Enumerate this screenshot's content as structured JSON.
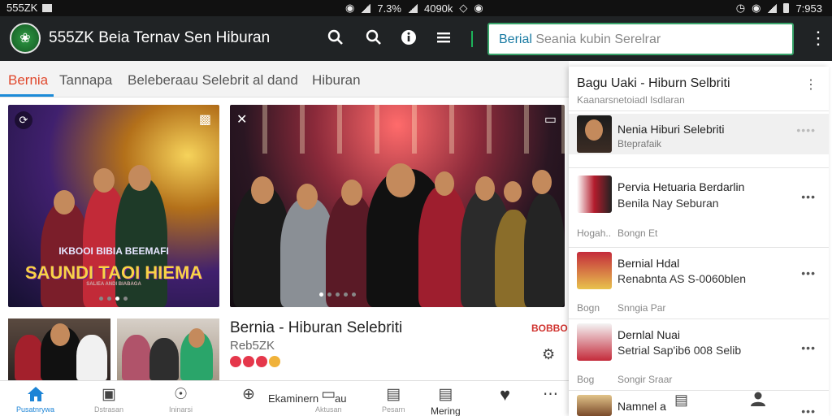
{
  "status_bar": {
    "carrier": "555ZK",
    "battery_percent": "7.3%",
    "speed": "4090k",
    "time": "7:953"
  },
  "app_bar": {
    "title": "555ZK Beia Ternav Sen Hiburan",
    "search": {
      "typed": "Berial",
      "placeholder": "Seania kubin Serelrar"
    },
    "icons": [
      "search-icon",
      "search-icon",
      "info-icon",
      "menu-icon",
      "more-vert-icon"
    ]
  },
  "tabs": [
    {
      "label": "Bernia",
      "active": true
    },
    {
      "label": "Tannapa",
      "active": false
    },
    {
      "label": "Beleberaau Selebrit al dand",
      "active": false
    },
    {
      "label": "Hiburan",
      "active": false
    }
  ],
  "hero": {
    "poster_title": "IKBOOI BIBIA BEEMAFI",
    "poster_headline": "SAUNDI TAOI HIEMA",
    "poster_credit": "SALIEA ANDI BIABAGA"
  },
  "feature": {
    "title": "Bernia - Hiburan Selebriti",
    "source": "Reb5ZK",
    "badge": "BOBBO"
  },
  "bottom_nav": [
    {
      "icon": "home-icon",
      "label": "Pusatnrywa",
      "active": true
    },
    {
      "icon": "image-icon",
      "label": "Dstrasan",
      "active": false
    },
    {
      "icon": "alert-circle-icon",
      "label": "Ininarsi",
      "active": false
    },
    {
      "icon": "plus-circle-icon",
      "label": "Ekaminern",
      "active": false
    },
    {
      "icon": "tv-icon",
      "label": "Au",
      "active": false
    },
    {
      "icon": "document-icon",
      "label": "Pesarn",
      "active": false
    },
    {
      "icon": "list-icon",
      "label": "Mering",
      "active": false
    },
    {
      "icon": "heart-icon",
      "label": "",
      "active": false
    },
    {
      "icon": "more-horiz-icon",
      "label": "",
      "active": false
    }
  ],
  "bottom_nav_texts": {
    "ekaminern": "Ekaminern",
    "au": "au",
    "mering": "Mering",
    "tv_sub": "Aktusan"
  },
  "panel": {
    "title": "Bagu Uaki - Hiburn Selbriti",
    "subtitle": "Kaanarsnetoiadl Isdlaran",
    "items": [
      {
        "line1": "Nenia Hiburi Selebriti",
        "line2": "Bteprafaik",
        "meta_left": "",
        "meta_right": "",
        "highlighted": true
      },
      {
        "line1": "Pervia Hetuaria Berdarlin",
        "line2": "Benila Nay Seburan",
        "meta_left": "Hogah..",
        "meta_right": "Bongn Et",
        "highlighted": false
      },
      {
        "line1": "Bernial Hdal",
        "line2": "Renabnta AS S-0060blen",
        "meta_left": "Bogn",
        "meta_right": "Snngia Par",
        "highlighted": false
      },
      {
        "line1": "Dernlal Nuai",
        "line2": "Setrial Sap'ib6 008 Selib",
        "meta_left": "Bog",
        "meta_right": "Songir Sraar",
        "highlighted": false
      },
      {
        "line1": "Namnel a",
        "line2": "",
        "meta_left": "",
        "meta_right": "",
        "highlighted": false
      }
    ],
    "bottom_icons": [
      "document-icon",
      "person-icon"
    ]
  },
  "colors": {
    "app_bar": "#202325",
    "accent_green": "#38a46a",
    "tab_active": "#e0482c",
    "nav_active": "#1c84d6"
  }
}
